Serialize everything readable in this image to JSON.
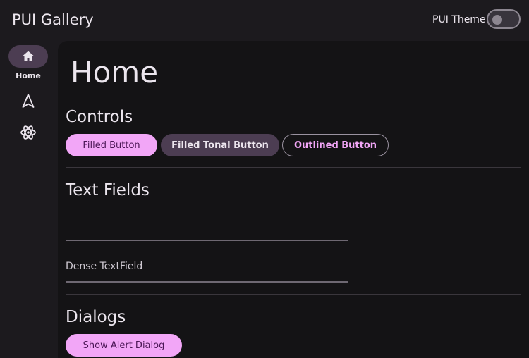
{
  "header": {
    "title": "PUI Gallery",
    "theme_label": "PUI Theme",
    "theme_toggle_on": false
  },
  "rail": {
    "items": [
      {
        "icon": "home-icon",
        "label": "Home",
        "selected": true
      },
      {
        "icon": "navigation-icon",
        "label": ""
      },
      {
        "icon": "atom-icon",
        "label": ""
      }
    ]
  },
  "main": {
    "title": "Home",
    "controls": {
      "title": "Controls",
      "filled_button": "Filled Button",
      "tonal_button": "Filled Tonal Button",
      "outlined_button": "Outlined Button"
    },
    "text_fields": {
      "title": "Text Fields",
      "field1_value": "",
      "field2_label": "Dense TextField"
    },
    "dialogs": {
      "title": "Dialogs",
      "alert_button": "Show Alert Dialog"
    }
  },
  "colors": {
    "accent": "#f2a6f7",
    "tonal": "#4c3d52",
    "background": "#141315"
  }
}
